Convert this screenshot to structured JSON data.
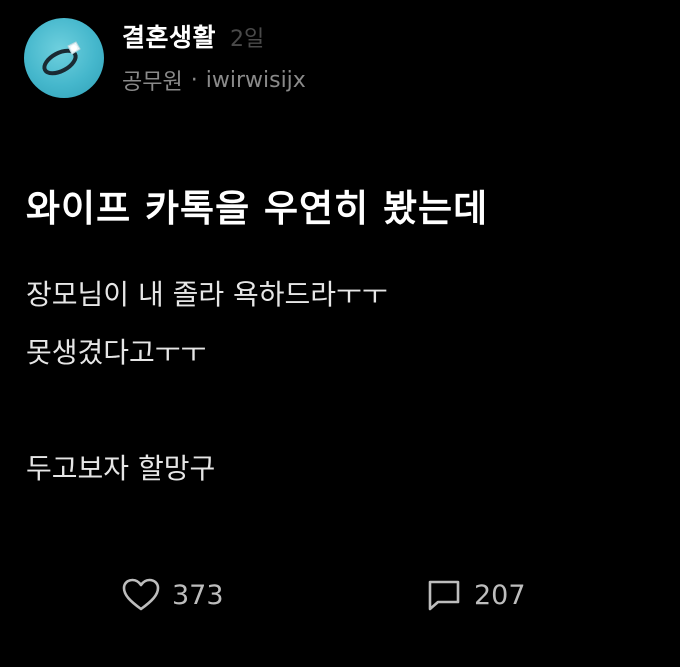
{
  "header": {
    "group_name": "결혼생활",
    "time": "2일",
    "author_job": "공무원",
    "separator": "·",
    "author_id": "iwirwisijx",
    "avatar_icon": "ring-icon"
  },
  "post": {
    "title": "와이프 카톡을 우연히 봤는데",
    "body_lines": [
      "장모님이 내 졸라 욕하드라ㅜㅜ",
      "못생겼다고ㅜㅜ",
      "두고보자 할망구"
    ]
  },
  "actions": {
    "likes": "373",
    "comments": "207",
    "like_icon": "heart-icon",
    "comment_icon": "comment-icon"
  },
  "colors": {
    "background": "#000000",
    "avatar_bg": "#45b7cc",
    "muted_text": "#8a8a8a"
  }
}
